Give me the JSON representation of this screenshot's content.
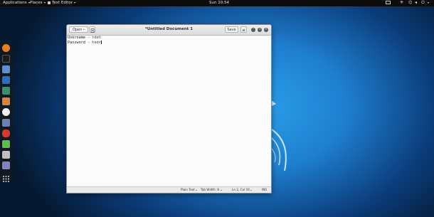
{
  "topbar": {
    "applications": "Applications",
    "places": "Places",
    "app_menu": "Text Editor",
    "clock": "Sun 10:54"
  },
  "dock": {
    "icons": [
      "firefox-icon",
      "terminal-icon",
      "files-icon",
      "metasploit-icon",
      "armitage-icon",
      "burpsuite-icon",
      "maltego-icon",
      "faraday-icon",
      "beef-icon",
      "leafpad-icon",
      "cherrytree-icon",
      "screenshot-icon",
      "app-grid-icon"
    ]
  },
  "window": {
    "open_label": "Open",
    "save_label": "Save",
    "title": "*Untitled Document 1",
    "lines": [
      "Username - root",
      "Password - toor"
    ],
    "status": {
      "language": "Plain Text",
      "tab_width": "Tab Width: 8",
      "position": "Ln 2, Col 16",
      "mode": "INS"
    }
  },
  "colors": {
    "topbar": "#0c0c0c",
    "desktop_center": "#2aa0ea",
    "desktop_edge": "#05182f"
  }
}
